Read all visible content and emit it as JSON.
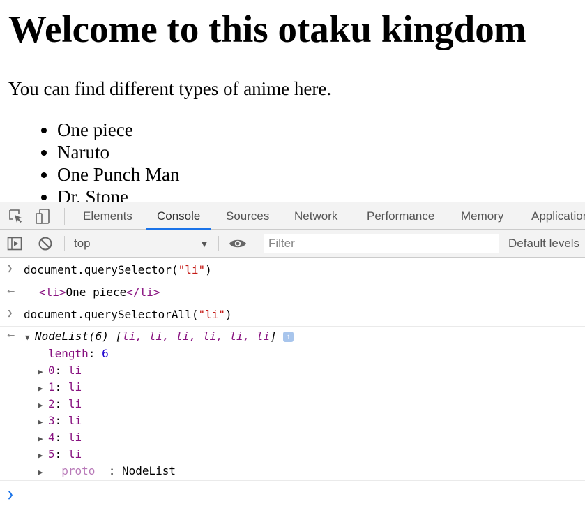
{
  "page": {
    "heading": "Welcome to this otaku kingdom",
    "intro": "You can find different types of anime here.",
    "anime": [
      "One piece",
      "Naruto",
      "One Punch Man",
      "Dr. Stone"
    ]
  },
  "devtools": {
    "icons": [
      "inspect-element-icon",
      "device-toggle-icon",
      "sidebar-toggle-icon",
      "clear-console-icon",
      "eye-icon",
      "dropdown-caret-icon"
    ],
    "tabs": [
      "Elements",
      "Console",
      "Sources",
      "Network",
      "Performance",
      "Memory",
      "Application"
    ],
    "active_tab": "Console",
    "context": "top",
    "filter_placeholder": "Filter",
    "levels_label": "Default levels",
    "accent": "#1a73e8"
  },
  "console": {
    "cmd1": {
      "fn": "document.querySelector(",
      "arg": "\"li\"",
      "close": ")"
    },
    "res1": {
      "open": "<li>",
      "text": "One piece",
      "close": "</li>"
    },
    "cmd2": {
      "fn": "document.querySelectorAll(",
      "arg": "\"li\"",
      "close": ")"
    },
    "res2": {
      "summary_type": "NodeList(6) [",
      "summary_items": "li, li, li, li, li, li",
      "summary_close": "]",
      "length_key": "length",
      "length_sep": ": ",
      "length_value": "6",
      "items": [
        {
          "key": "0",
          "value": "li"
        },
        {
          "key": "1",
          "value": "li"
        },
        {
          "key": "2",
          "value": "li"
        },
        {
          "key": "3",
          "value": "li"
        },
        {
          "key": "4",
          "value": "li"
        },
        {
          "key": "5",
          "value": "li"
        }
      ],
      "proto_key": "__proto__",
      "proto_sep": ": ",
      "proto_value": "NodeList"
    }
  }
}
